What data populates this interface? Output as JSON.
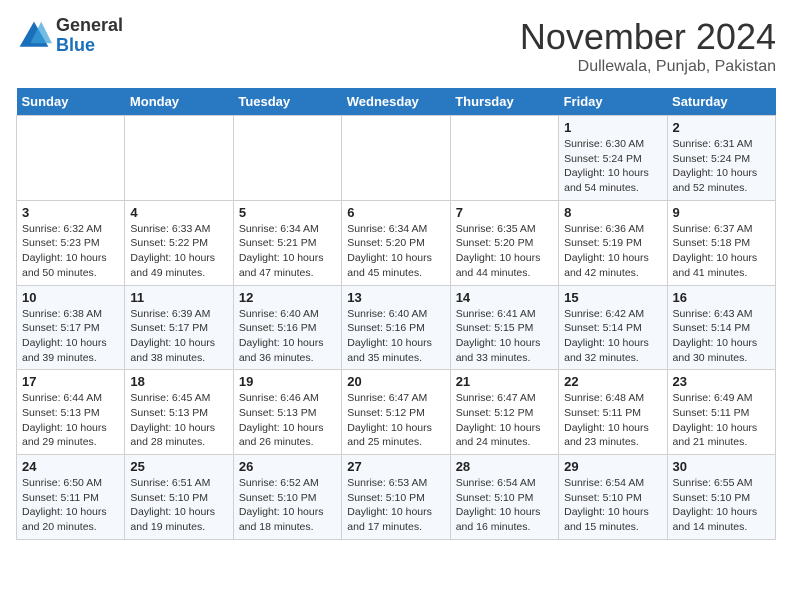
{
  "logo": {
    "general": "General",
    "blue": "Blue"
  },
  "header": {
    "month": "November 2024",
    "location": "Dullewala, Punjab, Pakistan"
  },
  "days_of_week": [
    "Sunday",
    "Monday",
    "Tuesday",
    "Wednesday",
    "Thursday",
    "Friday",
    "Saturday"
  ],
  "weeks": [
    [
      {
        "day": "",
        "info": ""
      },
      {
        "day": "",
        "info": ""
      },
      {
        "day": "",
        "info": ""
      },
      {
        "day": "",
        "info": ""
      },
      {
        "day": "",
        "info": ""
      },
      {
        "day": "1",
        "info": "Sunrise: 6:30 AM\nSunset: 5:24 PM\nDaylight: 10 hours and 54 minutes."
      },
      {
        "day": "2",
        "info": "Sunrise: 6:31 AM\nSunset: 5:24 PM\nDaylight: 10 hours and 52 minutes."
      }
    ],
    [
      {
        "day": "3",
        "info": "Sunrise: 6:32 AM\nSunset: 5:23 PM\nDaylight: 10 hours and 50 minutes."
      },
      {
        "day": "4",
        "info": "Sunrise: 6:33 AM\nSunset: 5:22 PM\nDaylight: 10 hours and 49 minutes."
      },
      {
        "day": "5",
        "info": "Sunrise: 6:34 AM\nSunset: 5:21 PM\nDaylight: 10 hours and 47 minutes."
      },
      {
        "day": "6",
        "info": "Sunrise: 6:34 AM\nSunset: 5:20 PM\nDaylight: 10 hours and 45 minutes."
      },
      {
        "day": "7",
        "info": "Sunrise: 6:35 AM\nSunset: 5:20 PM\nDaylight: 10 hours and 44 minutes."
      },
      {
        "day": "8",
        "info": "Sunrise: 6:36 AM\nSunset: 5:19 PM\nDaylight: 10 hours and 42 minutes."
      },
      {
        "day": "9",
        "info": "Sunrise: 6:37 AM\nSunset: 5:18 PM\nDaylight: 10 hours and 41 minutes."
      }
    ],
    [
      {
        "day": "10",
        "info": "Sunrise: 6:38 AM\nSunset: 5:17 PM\nDaylight: 10 hours and 39 minutes."
      },
      {
        "day": "11",
        "info": "Sunrise: 6:39 AM\nSunset: 5:17 PM\nDaylight: 10 hours and 38 minutes."
      },
      {
        "day": "12",
        "info": "Sunrise: 6:40 AM\nSunset: 5:16 PM\nDaylight: 10 hours and 36 minutes."
      },
      {
        "day": "13",
        "info": "Sunrise: 6:40 AM\nSunset: 5:16 PM\nDaylight: 10 hours and 35 minutes."
      },
      {
        "day": "14",
        "info": "Sunrise: 6:41 AM\nSunset: 5:15 PM\nDaylight: 10 hours and 33 minutes."
      },
      {
        "day": "15",
        "info": "Sunrise: 6:42 AM\nSunset: 5:14 PM\nDaylight: 10 hours and 32 minutes."
      },
      {
        "day": "16",
        "info": "Sunrise: 6:43 AM\nSunset: 5:14 PM\nDaylight: 10 hours and 30 minutes."
      }
    ],
    [
      {
        "day": "17",
        "info": "Sunrise: 6:44 AM\nSunset: 5:13 PM\nDaylight: 10 hours and 29 minutes."
      },
      {
        "day": "18",
        "info": "Sunrise: 6:45 AM\nSunset: 5:13 PM\nDaylight: 10 hours and 28 minutes."
      },
      {
        "day": "19",
        "info": "Sunrise: 6:46 AM\nSunset: 5:13 PM\nDaylight: 10 hours and 26 minutes."
      },
      {
        "day": "20",
        "info": "Sunrise: 6:47 AM\nSunset: 5:12 PM\nDaylight: 10 hours and 25 minutes."
      },
      {
        "day": "21",
        "info": "Sunrise: 6:47 AM\nSunset: 5:12 PM\nDaylight: 10 hours and 24 minutes."
      },
      {
        "day": "22",
        "info": "Sunrise: 6:48 AM\nSunset: 5:11 PM\nDaylight: 10 hours and 23 minutes."
      },
      {
        "day": "23",
        "info": "Sunrise: 6:49 AM\nSunset: 5:11 PM\nDaylight: 10 hours and 21 minutes."
      }
    ],
    [
      {
        "day": "24",
        "info": "Sunrise: 6:50 AM\nSunset: 5:11 PM\nDaylight: 10 hours and 20 minutes."
      },
      {
        "day": "25",
        "info": "Sunrise: 6:51 AM\nSunset: 5:10 PM\nDaylight: 10 hours and 19 minutes."
      },
      {
        "day": "26",
        "info": "Sunrise: 6:52 AM\nSunset: 5:10 PM\nDaylight: 10 hours and 18 minutes."
      },
      {
        "day": "27",
        "info": "Sunrise: 6:53 AM\nSunset: 5:10 PM\nDaylight: 10 hours and 17 minutes."
      },
      {
        "day": "28",
        "info": "Sunrise: 6:54 AM\nSunset: 5:10 PM\nDaylight: 10 hours and 16 minutes."
      },
      {
        "day": "29",
        "info": "Sunrise: 6:54 AM\nSunset: 5:10 PM\nDaylight: 10 hours and 15 minutes."
      },
      {
        "day": "30",
        "info": "Sunrise: 6:55 AM\nSunset: 5:10 PM\nDaylight: 10 hours and 14 minutes."
      }
    ]
  ]
}
